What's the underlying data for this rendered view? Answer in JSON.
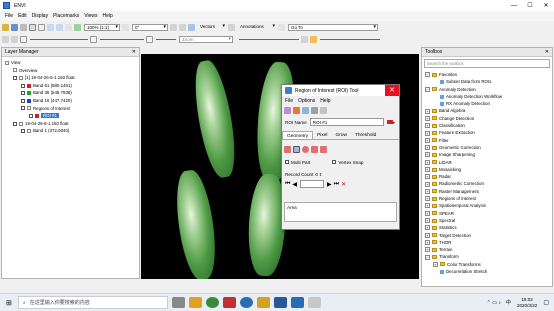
{
  "window": {
    "title": "ENVI",
    "min": "—",
    "max": "☐",
    "close": "✕"
  },
  "menu": [
    "File",
    "Edit",
    "Display",
    "Placemarks",
    "Views",
    "Help"
  ],
  "toolbar1": {
    "zoom": "100% (1:1)",
    "rotation": "0°",
    "vectors": "Vectors",
    "annotations": "Annotations",
    "goto": "Go To"
  },
  "toolbar2": {
    "search_placeholder": "Zoom"
  },
  "layer_manager": {
    "title": "Layer Manager",
    "rows": [
      {
        "label": "View",
        "color": "",
        "indent": 0
      },
      {
        "label": "Overview",
        "color": "",
        "indent": 1
      },
      {
        "label": "[1] 19-04-26-6-1.150 float",
        "color": "",
        "indent": 1
      },
      {
        "label": "Band 61 (680.1461)",
        "color": "#d02020",
        "indent": 2
      },
      {
        "label": "Band 36 (549.7938)",
        "color": "#20a020",
        "indent": 2
      },
      {
        "label": "Band 16 (447.7420)",
        "color": "#2040d0",
        "indent": 2
      },
      {
        "label": "Regions of Interest",
        "color": "",
        "indent": 2
      },
      {
        "label": "ROI #1",
        "color": "#d02020",
        "indent": 3
      },
      {
        "label": "19-04-26-6-1.150 float",
        "color": "",
        "indent": 1
      },
      {
        "label": "Band 1 (372.5040)",
        "color": "",
        "indent": 2
      }
    ]
  },
  "roi_tool": {
    "title": "Region of Interest (ROI) Tool",
    "menu": [
      "File",
      "Options",
      "Help"
    ],
    "roi_name_label": "ROI Name",
    "roi_name_value": "ROI #1",
    "tabs": [
      "Geometry",
      "Pixel",
      "Grow",
      "Threshold"
    ],
    "multi_part": "Multi Part",
    "vertex_snap": "Vertex Snap",
    "record_count_label": "Record Count",
    "record_count_value": "0",
    "area_label": "Area"
  },
  "toolbox": {
    "title": "Toolbox",
    "search_placeholder": "Search the toolbox",
    "rows": [
      {
        "label": "Favorites",
        "type": "folder",
        "indent": 0
      },
      {
        "label": "Subset Data from ROIs",
        "type": "tool",
        "indent": 1
      },
      {
        "label": "Anomaly Detection",
        "type": "folder",
        "indent": 0
      },
      {
        "label": "Anomaly Detection Workflow",
        "type": "tool",
        "indent": 1
      },
      {
        "label": "RX Anomaly Detection",
        "type": "tool",
        "indent": 1
      },
      {
        "label": "Band Algebra",
        "type": "folder",
        "indent": 0
      },
      {
        "label": "Change Detection",
        "type": "folder",
        "indent": 0
      },
      {
        "label": "Classification",
        "type": "folder",
        "indent": 0
      },
      {
        "label": "Feature Extraction",
        "type": "folder",
        "indent": 0
      },
      {
        "label": "Filter",
        "type": "folder",
        "indent": 0
      },
      {
        "label": "Geometric Correction",
        "type": "folder",
        "indent": 0
      },
      {
        "label": "Image Sharpening",
        "type": "folder",
        "indent": 0
      },
      {
        "label": "LiDAR",
        "type": "folder",
        "indent": 0
      },
      {
        "label": "Mosaicking",
        "type": "folder",
        "indent": 0
      },
      {
        "label": "Radar",
        "type": "folder",
        "indent": 0
      },
      {
        "label": "Radiometric Correction",
        "type": "folder",
        "indent": 0
      },
      {
        "label": "Raster Management",
        "type": "folder",
        "indent": 0
      },
      {
        "label": "Regions of Interest",
        "type": "folder",
        "indent": 0
      },
      {
        "label": "Spatiotemporal Analysis",
        "type": "folder",
        "indent": 0
      },
      {
        "label": "SPEAR",
        "type": "folder",
        "indent": 0
      },
      {
        "label": "Spectral",
        "type": "folder",
        "indent": 0
      },
      {
        "label": "Statistics",
        "type": "folder",
        "indent": 0
      },
      {
        "label": "Target Detection",
        "type": "folder",
        "indent": 0
      },
      {
        "label": "THOR",
        "type": "folder",
        "indent": 0
      },
      {
        "label": "Terrain",
        "type": "folder",
        "indent": 0
      },
      {
        "label": "Transform",
        "type": "folder",
        "indent": 0
      },
      {
        "label": "Color Transforms",
        "type": "folder",
        "indent": 1
      },
      {
        "label": "Decorrelation Stretch",
        "type": "tool",
        "indent": 1
      }
    ]
  },
  "taskbar": {
    "search_placeholder": "在这里输入你要搜索的内容",
    "time": "15:02",
    "date": "2020/3/22",
    "lang": "中"
  }
}
